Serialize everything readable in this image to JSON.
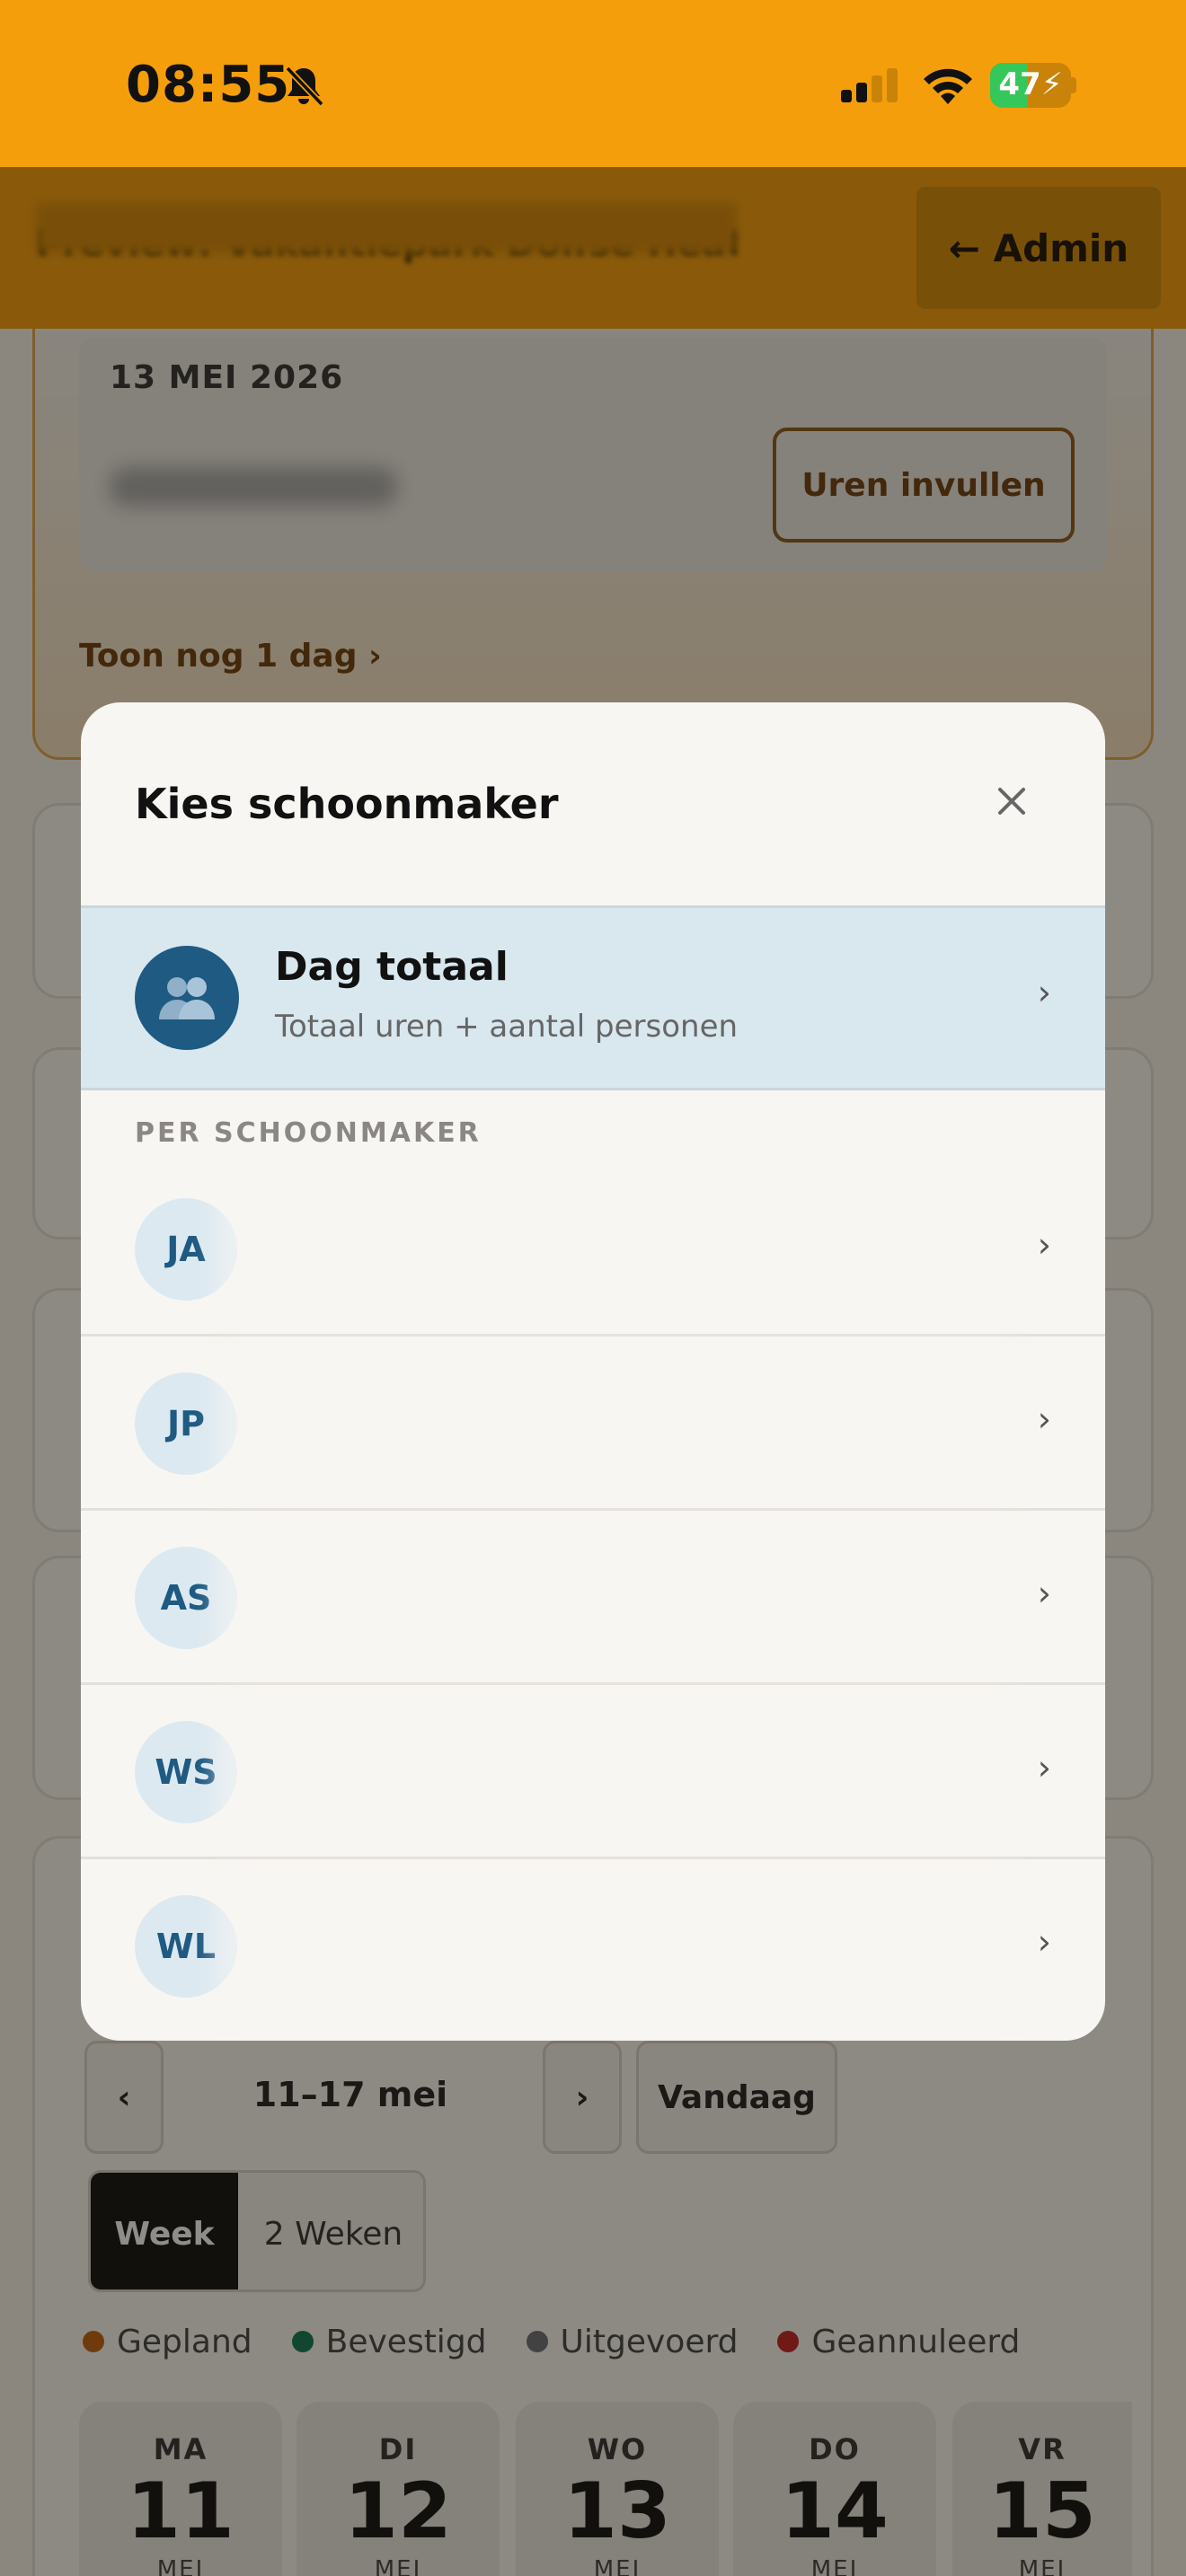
{
  "status_bar": {
    "time": "08:55",
    "battery": "47",
    "battery_level": 0.47,
    "icons": [
      "bell-slash-icon",
      "signal-icon",
      "wifi-icon",
      "battery-charging-icon"
    ]
  },
  "header": {
    "title": "Preview: Vakantiepark Dolfse Heat",
    "admin_button": "← Admin"
  },
  "background": {
    "date": "13 MEI 2026",
    "fill_hours_button": "Uren invullen",
    "show_more": "Toon nog 1 dag ›",
    "calendar": {
      "prev": "‹",
      "range": "11–17 mei",
      "next": "›",
      "today_button": "Vandaag",
      "views": [
        "Week",
        "2 Weken"
      ],
      "legend": [
        {
          "label": "Gepland",
          "color": "#c2620e"
        },
        {
          "label": "Bevestigd",
          "color": "#0e7a53"
        },
        {
          "label": "Uitgevoerd",
          "color": "#6b6f76"
        },
        {
          "label": "Geannuleerd",
          "color": "#c22424"
        }
      ],
      "days": [
        {
          "name": "MA",
          "num": "11",
          "month": "MEI"
        },
        {
          "name": "DI",
          "num": "12",
          "month": "MEI"
        },
        {
          "name": "WO",
          "num": "13",
          "month": "MEI"
        },
        {
          "name": "DO",
          "num": "14",
          "month": "MEI"
        },
        {
          "name": "VR",
          "num": "15",
          "month": "MEI"
        }
      ]
    }
  },
  "modal": {
    "title": "Kies schoonmaker",
    "close_icon": "close-icon",
    "day_total": {
      "title": "Dag totaal",
      "subtitle": "Totaal uren + aantal personen",
      "icon": "people-icon",
      "chevron": "›"
    },
    "section_label": "PER SCHOONMAKER",
    "cleaners": [
      {
        "initials": "JA",
        "chevron": "›"
      },
      {
        "initials": "JP",
        "chevron": "›"
      },
      {
        "initials": "AS",
        "chevron": "›"
      },
      {
        "initials": "WS",
        "chevron": "›"
      },
      {
        "initials": "WL",
        "chevron": "›"
      }
    ]
  }
}
